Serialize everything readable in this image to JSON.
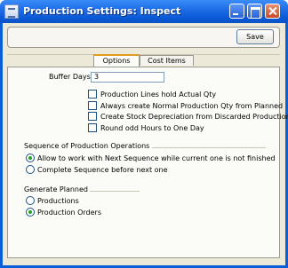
{
  "window": {
    "title": "Production Settings: Inspect"
  },
  "toolbar": {
    "save_label": "Save"
  },
  "tabs": [
    {
      "label": "Options",
      "active": true
    },
    {
      "label": "Cost Items",
      "active": false
    }
  ],
  "buffer_days": {
    "label": "Buffer Days",
    "value": "3"
  },
  "checkboxes": [
    {
      "label": "Production Lines hold Actual Qty",
      "checked": false
    },
    {
      "label": "Always create Normal Production Qty from Planned",
      "checked": false
    },
    {
      "label": "Create Stock Depreciation from Discarded Production",
      "checked": false
    },
    {
      "label": "Round odd Hours to One Day",
      "checked": false
    }
  ],
  "sequence": {
    "heading": "Sequence of Production Operations",
    "options": [
      {
        "label": "Allow to work with Next Sequence while current one is not finished",
        "selected": true
      },
      {
        "label": "Complete Sequence before next one",
        "selected": false
      }
    ]
  },
  "generate": {
    "heading": "Generate Planned",
    "options": [
      {
        "label": "Productions",
        "selected": false
      },
      {
        "label": "Production Orders",
        "selected": true
      }
    ]
  },
  "colors": {
    "title_bar": "#0a58d4",
    "radio_dot": "#21a121",
    "tab_accent": "#e39a20",
    "background": "#ece9d8"
  },
  "icons": {
    "app": "app-window-icon",
    "minimize": "minimize-icon",
    "maximize": "maximize-icon",
    "close": "close-icon"
  }
}
